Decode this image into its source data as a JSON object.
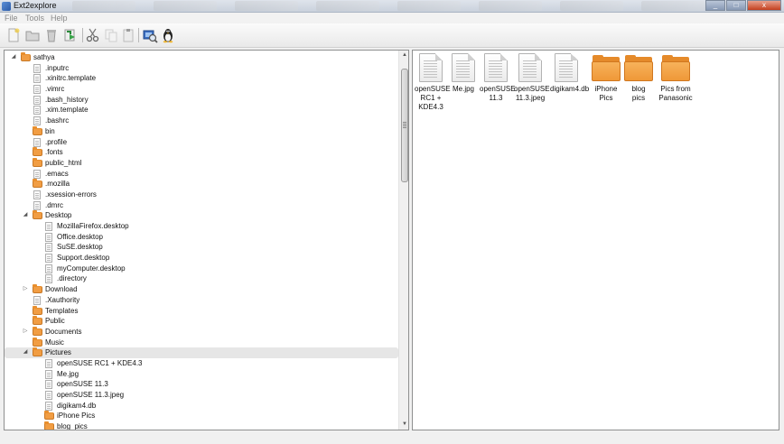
{
  "window": {
    "title": "Ext2explore",
    "minimize_glyph": "_",
    "maximize_glyph": "□",
    "close_glyph": "x"
  },
  "menu": [
    "File",
    "Tools",
    "Help"
  ],
  "toolbar": {
    "icons": [
      "new-file-icon",
      "open-folder-icon",
      "delete-icon",
      "refresh-icon",
      "cut-icon",
      "copy-icon",
      "paste-icon",
      "disk-scan-icon",
      "linux-tux-icon"
    ]
  },
  "tree": {
    "expanded_glyph": "◢",
    "collapsed_glyph": "▷",
    "rows": [
      {
        "label": "sathya",
        "kind": "folder",
        "depth": 0,
        "toggle": "expanded"
      },
      {
        "label": ".inputrc",
        "kind": "file",
        "depth": 1,
        "toggle": "none"
      },
      {
        "label": ".xinitrc.template",
        "kind": "file",
        "depth": 1,
        "toggle": "none"
      },
      {
        "label": ".vimrc",
        "kind": "file",
        "depth": 1,
        "toggle": "none"
      },
      {
        "label": ".bash_history",
        "kind": "file",
        "depth": 1,
        "toggle": "none"
      },
      {
        "label": ".xim.template",
        "kind": "file",
        "depth": 1,
        "toggle": "none"
      },
      {
        "label": ".bashrc",
        "kind": "file",
        "depth": 1,
        "toggle": "none"
      },
      {
        "label": "bin",
        "kind": "folder",
        "depth": 1,
        "toggle": "none"
      },
      {
        "label": ".profile",
        "kind": "file",
        "depth": 1,
        "toggle": "none"
      },
      {
        "label": ".fonts",
        "kind": "folder",
        "depth": 1,
        "toggle": "none"
      },
      {
        "label": "public_html",
        "kind": "folder",
        "depth": 1,
        "toggle": "none"
      },
      {
        "label": ".emacs",
        "kind": "file",
        "depth": 1,
        "toggle": "none"
      },
      {
        "label": ".mozilla",
        "kind": "folder",
        "depth": 1,
        "toggle": "none"
      },
      {
        "label": ".xsession-errors",
        "kind": "file",
        "depth": 1,
        "toggle": "none"
      },
      {
        "label": ".dmrc",
        "kind": "file",
        "depth": 1,
        "toggle": "none"
      },
      {
        "label": "Desktop",
        "kind": "folder",
        "depth": 1,
        "toggle": "expanded"
      },
      {
        "label": "MozillaFirefox.desktop",
        "kind": "file",
        "depth": 2,
        "toggle": "none"
      },
      {
        "label": "Office.desktop",
        "kind": "file",
        "depth": 2,
        "toggle": "none"
      },
      {
        "label": "SuSE.desktop",
        "kind": "file",
        "depth": 2,
        "toggle": "none"
      },
      {
        "label": "Support.desktop",
        "kind": "file",
        "depth": 2,
        "toggle": "none"
      },
      {
        "label": "myComputer.desktop",
        "kind": "file",
        "depth": 2,
        "toggle": "none"
      },
      {
        "label": ".directory",
        "kind": "file",
        "depth": 2,
        "toggle": "none"
      },
      {
        "label": "Download",
        "kind": "folder",
        "depth": 1,
        "toggle": "collapsed"
      },
      {
        "label": ".Xauthority",
        "kind": "file",
        "depth": 1,
        "toggle": "none"
      },
      {
        "label": "Templates",
        "kind": "folder",
        "depth": 1,
        "toggle": "none"
      },
      {
        "label": "Public",
        "kind": "folder",
        "depth": 1,
        "toggle": "none"
      },
      {
        "label": "Documents",
        "kind": "folder",
        "depth": 1,
        "toggle": "collapsed"
      },
      {
        "label": "Music",
        "kind": "folder",
        "depth": 1,
        "toggle": "none"
      },
      {
        "label": "Pictures",
        "kind": "folder",
        "depth": 1,
        "toggle": "expanded",
        "selected": true
      },
      {
        "label": "openSUSE RC1 + KDE4.3",
        "kind": "file",
        "depth": 2,
        "toggle": "none"
      },
      {
        "label": "Me.jpg",
        "kind": "file",
        "depth": 2,
        "toggle": "none"
      },
      {
        "label": "openSUSE 11.3",
        "kind": "file",
        "depth": 2,
        "toggle": "none"
      },
      {
        "label": "openSUSE 11.3.jpeg",
        "kind": "file",
        "depth": 2,
        "toggle": "none"
      },
      {
        "label": "digikam4.db",
        "kind": "file",
        "depth": 2,
        "toggle": "none"
      },
      {
        "label": "iPhone Pics",
        "kind": "folder",
        "depth": 2,
        "toggle": "none"
      },
      {
        "label": "blog_pics",
        "kind": "folder",
        "depth": 2,
        "toggle": "none"
      }
    ]
  },
  "scrollbar": {
    "up_glyph": "▲",
    "down_glyph": "▼"
  },
  "files": [
    {
      "lines": [
        "openSUSE",
        "RC1 +",
        "KDE4.3"
      ],
      "kind": "file"
    },
    {
      "lines": [
        "Me.jpg"
      ],
      "kind": "file"
    },
    {
      "lines": [
        "openSUSE",
        "11.3"
      ],
      "kind": "file"
    },
    {
      "lines": [
        "openSUSE",
        "11.3.jpeg"
      ],
      "kind": "file"
    },
    {
      "lines": [
        "digikam4.db"
      ],
      "kind": "file"
    },
    {
      "lines": [
        "iPhone",
        "Pics"
      ],
      "kind": "folder"
    },
    {
      "lines": [
        "blog",
        "pics"
      ],
      "kind": "folder"
    },
    {
      "lines": [
        "Pics from",
        "Panasonic"
      ],
      "kind": "folder"
    }
  ],
  "colors": {
    "folder": "#f19d43",
    "selection": "#e6e6e6",
    "close_button": "#c4401e"
  }
}
